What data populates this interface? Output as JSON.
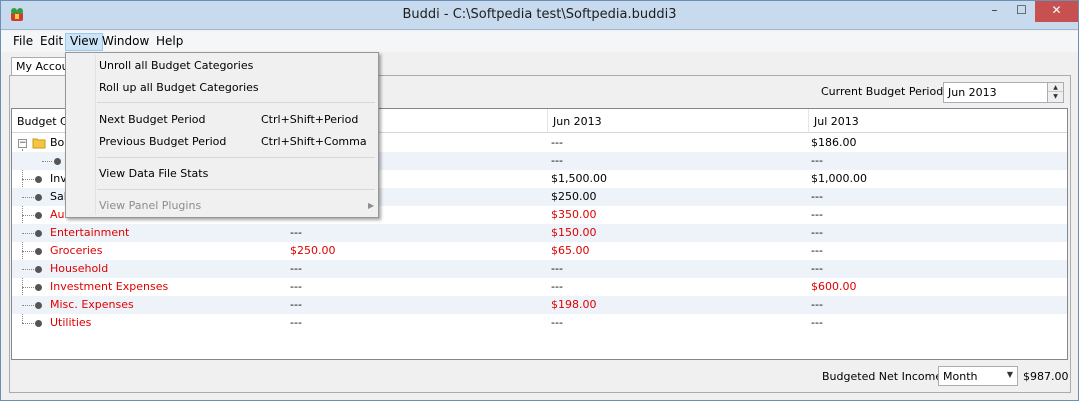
{
  "window": {
    "title": "Buddi - C:\\Softpedia test\\Softpedia.buddi3",
    "minimize_glyph": "–",
    "maximize_glyph": "☐",
    "close_glyph": "✕"
  },
  "menubar": [
    "File",
    "Edit",
    "View",
    "Window",
    "Help"
  ],
  "tab": {
    "label": "My Accou"
  },
  "budget_period": {
    "label": "Current Budget Period",
    "value": "Jun 2013"
  },
  "table": {
    "headers": [
      "Budget Ca",
      "",
      "Jun 2013",
      "Jul 2013"
    ],
    "rows": [
      {
        "name": "Bon",
        "col1": "",
        "col2": "---",
        "col3": "$186.00",
        "red": false,
        "kind": "folder"
      },
      {
        "name": "",
        "col1": "",
        "col2": "---",
        "col3": "---",
        "red": false,
        "kind": "child"
      },
      {
        "name": "Inv",
        "col1": "",
        "col2": "$1,500.00",
        "col3": "$1,000.00",
        "red": false,
        "kind": "leaf"
      },
      {
        "name": "Sal",
        "col1": "",
        "col2": "$250.00",
        "col3": "---",
        "red": false,
        "kind": "leaf"
      },
      {
        "name": "Aut",
        "col1": "",
        "col2": "$350.00",
        "col3": "---",
        "red": true,
        "kind": "leaf"
      },
      {
        "name": "Entertainment",
        "col1": "---",
        "col2": "$150.00",
        "col3": "---",
        "red": true,
        "kind": "leaf"
      },
      {
        "name": "Groceries",
        "col1": "$250.00",
        "col2": "$65.00",
        "col3": "---",
        "red": true,
        "kind": "leaf"
      },
      {
        "name": "Household",
        "col1": "---",
        "col2": "---",
        "col3": "---",
        "red": true,
        "kind": "leaf"
      },
      {
        "name": "Investment Expenses",
        "col1": "---",
        "col2": "---",
        "col3": "$600.00",
        "red": true,
        "kind": "leaf"
      },
      {
        "name": "Misc. Expenses",
        "col1": "---",
        "col2": "$198.00",
        "col3": "---",
        "red": true,
        "kind": "leaf"
      },
      {
        "name": "Utilities",
        "col1": "---",
        "col2": "---",
        "col3": "---",
        "red": true,
        "kind": "leaf"
      }
    ]
  },
  "footer": {
    "label": "Budgeted Net Income /",
    "select_value": "Month",
    "amount": "$987.00"
  },
  "view_menu": {
    "items": [
      {
        "label": "Unroll all Budget Categories",
        "shortcut": ""
      },
      {
        "label": "Roll up all Budget Categories",
        "shortcut": ""
      },
      {
        "label": "Next Budget Period",
        "shortcut": "Ctrl+Shift+Period"
      },
      {
        "label": "Previous Budget Period",
        "shortcut": "Ctrl+Shift+Comma"
      },
      {
        "label": "View Data File Stats",
        "shortcut": ""
      },
      {
        "label": "View Panel Plugins",
        "shortcut": "",
        "disabled": true
      }
    ]
  },
  "colors": {
    "titlebar": "#c7daee",
    "negative": "#e00000",
    "alt_row": "#eef3fa",
    "close": "#c75050"
  }
}
